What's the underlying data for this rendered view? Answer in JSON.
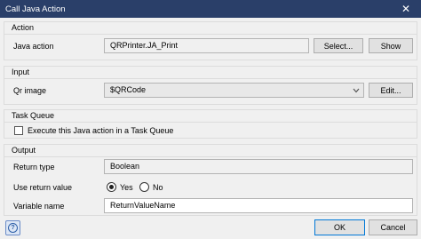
{
  "window": {
    "title": "Call Java Action",
    "close_glyph": "✕"
  },
  "action": {
    "group_title": "Action",
    "java_action_label": "Java action",
    "java_action_value": "QRPrinter.JA_Print",
    "select_button": "Select...",
    "show_button": "Show"
  },
  "input": {
    "group_title": "Input",
    "qr_image_label": "Qr image",
    "qr_image_value": "$QRCode",
    "edit_button": "Edit..."
  },
  "task_queue": {
    "group_title": "Task Queue",
    "checkbox_label": "Execute this Java action in a Task Queue",
    "checked": false
  },
  "output": {
    "group_title": "Output",
    "return_type_label": "Return type",
    "return_type_value": "Boolean",
    "use_return_label": "Use return value",
    "yes_label": "Yes",
    "no_label": "No",
    "selected": "Yes",
    "variable_name_label": "Variable name",
    "variable_name_value": "ReturnValueName"
  },
  "footer": {
    "help_glyph": "?",
    "ok_button": "OK",
    "cancel_button": "Cancel"
  },
  "colors": {
    "titlebar": "#2a3f69",
    "accent": "#0078d7",
    "background": "#f0f0f0"
  }
}
